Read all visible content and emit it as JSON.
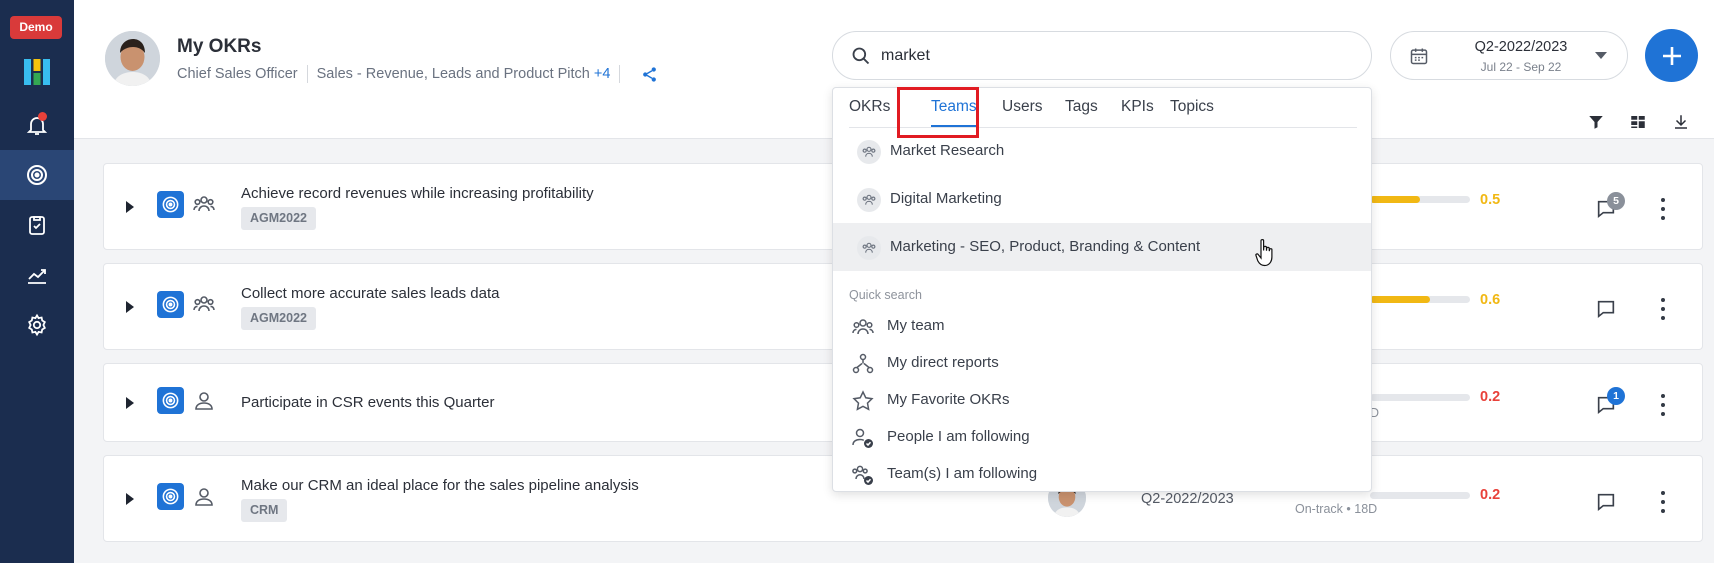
{
  "sidebar": {
    "demo_badge": "Demo",
    "items": [
      {
        "icon": "bell-icon",
        "label": "Notifications"
      },
      {
        "icon": "target-icon",
        "label": "OKRs",
        "active": true
      },
      {
        "icon": "clipboard-icon",
        "label": "Check-ins"
      },
      {
        "icon": "chart-icon",
        "label": "Reports"
      },
      {
        "icon": "gear-icon",
        "label": "Settings"
      }
    ]
  },
  "header": {
    "title": "My OKRs",
    "role": "Chief Sales Officer",
    "teams": "Sales - Revenue, Leads and Product Pitch",
    "teams_more": "+4",
    "search_value": "market",
    "period_title": "Q2-2022/2023",
    "period_sub": "Jul 22 - Sep 22"
  },
  "cards": [
    {
      "title": "Achieve record revenues while increasing profitability",
      "tag": "AGM2022",
      "type": "team",
      "progress": 0.5,
      "score": "0.5",
      "score_color": "#f1b814",
      "comments": "5",
      "badge_color": "#8a909a"
    },
    {
      "title": "Collect more accurate sales leads data",
      "tag": "AGM2022",
      "type": "team",
      "progress": 0.6,
      "score": "0.6",
      "score_color": "#f1b814",
      "comments": "",
      "badge_color": ""
    },
    {
      "title": "Participate in CSR events this Quarter",
      "tag": "",
      "type": "user",
      "progress": 0.2,
      "score": "0.2",
      "score_color": "#e8413a",
      "comments": "1",
      "badge_color": "#1f73d6",
      "status_tail": "D"
    },
    {
      "title": "Make our CRM an ideal place for the sales pipeline analysis",
      "tag": "CRM",
      "type": "user",
      "progress": 0.2,
      "score": "0.2",
      "score_color": "#e8413a",
      "comments": "",
      "badge_color": "",
      "period": "Q2-2022/2023",
      "status": "On-track • 18D"
    }
  ],
  "dropdown": {
    "tabs": [
      "OKRs",
      "Teams",
      "Users",
      "Tags",
      "KPIs",
      "Topics"
    ],
    "active_tab": "Teams",
    "results": [
      "Market Research",
      "Digital Marketing",
      "Marketing - SEO, Product, Branding & Content"
    ],
    "quick_search_label": "Quick search",
    "quick_search": [
      "My team",
      "My direct reports",
      "My Favorite OKRs",
      "People I am following",
      "Team(s) I am following"
    ]
  },
  "colors": {
    "brand": "#1f73d6",
    "sidebar": "#1b2d4f",
    "danger": "#e8413a",
    "warning": "#f1b814"
  }
}
